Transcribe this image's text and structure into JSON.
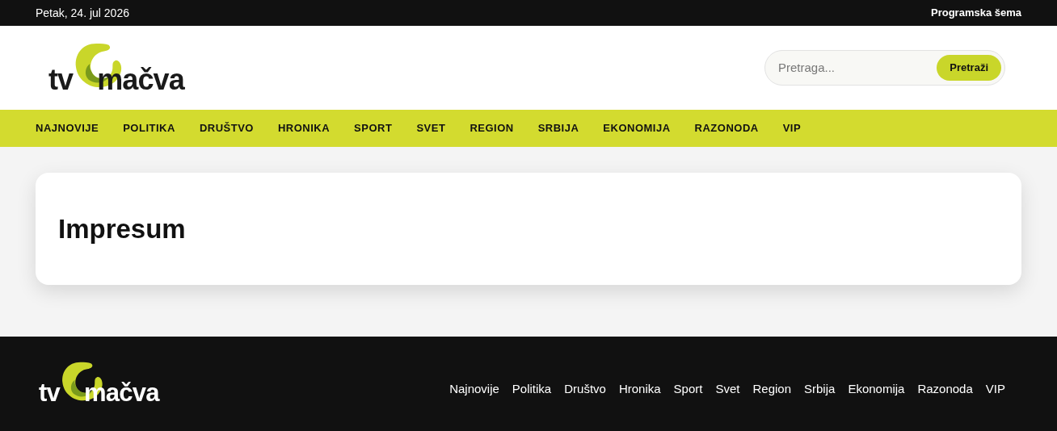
{
  "top_bar": {
    "date": "Petak, 24. jul 2026",
    "link": "Programska šema"
  },
  "header": {
    "logo": [
      "tv",
      "mačva"
    ],
    "search": {
      "placeholder": "Pretraga...",
      "button": "Pretraži"
    }
  },
  "nav": [
    "NAJNOVIJE",
    "POLITIKA",
    "DRUŠTVO",
    "HRONIKA",
    "SPORT",
    "SVET",
    "REGION",
    "SRBIJA",
    "EKONOMIJA",
    "RAZONODA",
    "VIP"
  ],
  "page": {
    "title": "Impresum"
  },
  "footer": {
    "logo": [
      "tv",
      "mačva"
    ],
    "links": [
      "Najnovije",
      "Politika",
      "Društvo",
      "Hronika",
      "Sport",
      "Svet",
      "Region",
      "Srbija",
      "Ekonomija",
      "Razonoda",
      "VIP"
    ]
  }
}
